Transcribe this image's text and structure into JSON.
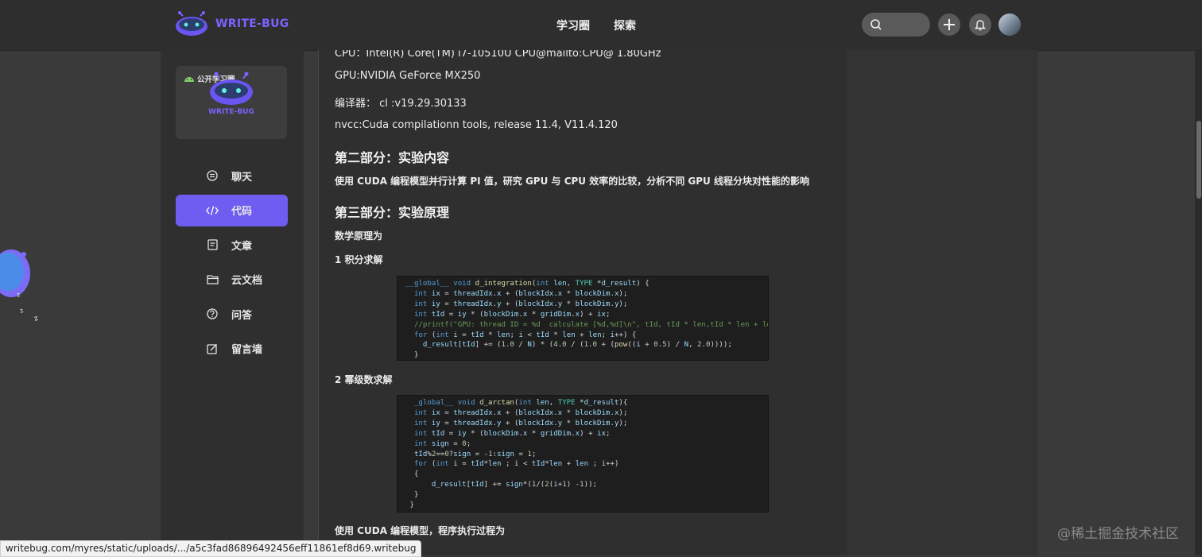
{
  "header": {
    "brand": "WRITE-BUG",
    "nav": [
      "学习圈",
      "探索"
    ]
  },
  "sidebar": {
    "circle_badge": "公开学习圈",
    "circle_logo_text": "WRITE-BUG",
    "items": [
      {
        "label": "聊天",
        "icon": "chat-icon"
      },
      {
        "label": "代码",
        "icon": "code-icon",
        "active": true
      },
      {
        "label": "文章",
        "icon": "article-icon"
      },
      {
        "label": "云文档",
        "icon": "folder-icon"
      },
      {
        "label": "问答",
        "icon": "question-icon"
      },
      {
        "label": "留言墙",
        "icon": "edit-icon"
      }
    ]
  },
  "article": {
    "cpu_line": "CPU：Intel(R) Core(TM) i7-10510U CPU@mailto:CPU@ 1.80GHz",
    "gpu_line": "GPU:NVIDIA GeForce MX250",
    "compiler_line": "编译器： cl :v19.29.30133",
    "nvcc_line": "nvcc:Cuda compilationn tools, release 11.4, V11.4.120",
    "section2_title": "第二部分：实验内容",
    "section2_text": "使用 CUDA 编程模型并行计算 PI 值，研究 GPU 与 CPU 效率的比较，分析不同 GPU 线程分块对性能的影响",
    "section3_title": "第三部分：实验原理",
    "math_title": "数学原理为",
    "integral_title": "1 积分求解",
    "series_title": "2 幂级数求解",
    "cuda_flow_title": "使用 CUDA 编程模型，程序执行过程为"
  },
  "status_url": "writebug.com/myres/static/uploads/.../a5c3fad86896492456eff11861ef8d69.writebug",
  "watermark": "@稀土掘金技术社区",
  "colors": {
    "accent": "#6f5cf1",
    "brand": "#7a63ff"
  }
}
